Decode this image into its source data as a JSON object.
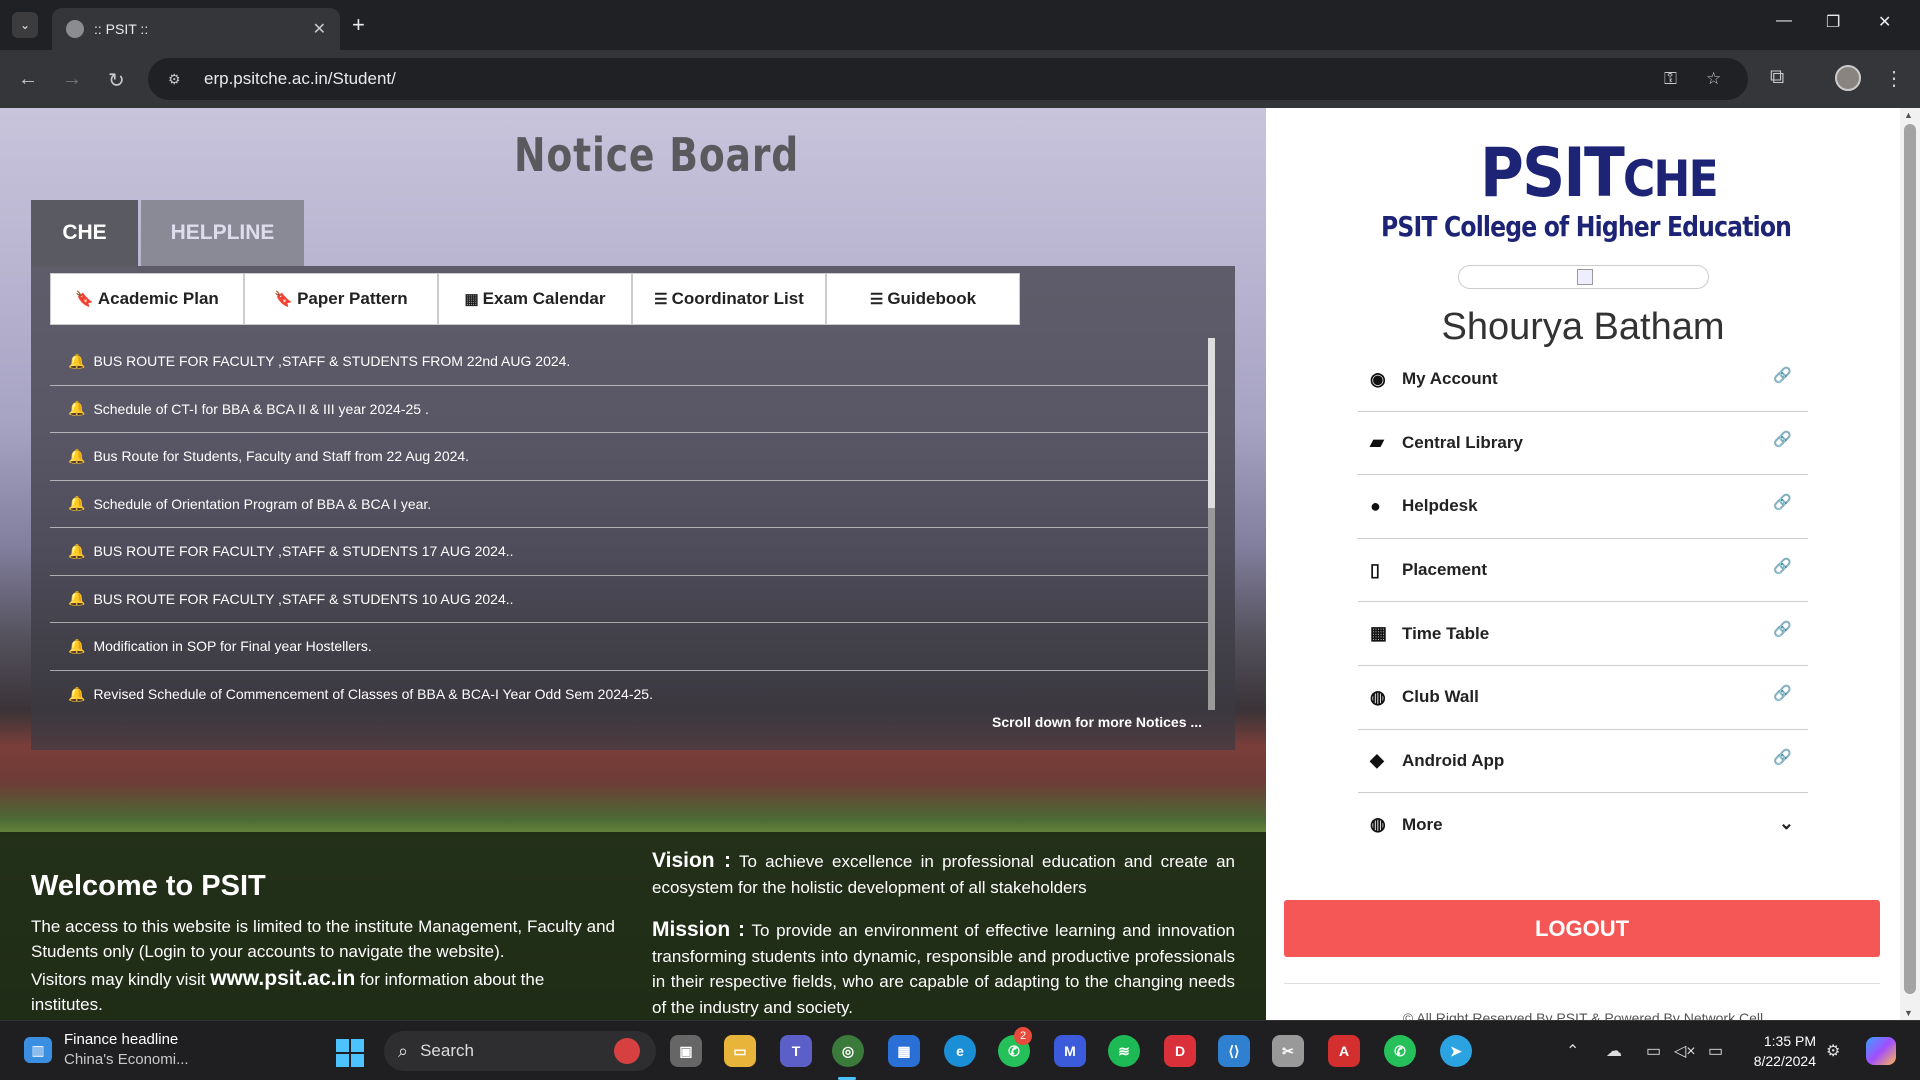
{
  "browser": {
    "tab_title": ":: PSIT ::",
    "url": "erp.psitche.ac.in/Student/"
  },
  "notice_board": {
    "title": "Notice Board",
    "tabs": [
      "CHE",
      "HELPLINE"
    ],
    "pills": [
      "Academic Plan",
      "Paper Pattern",
      "Exam Calendar",
      "Coordinator List",
      "Guidebook"
    ],
    "notices": [
      "BUS ROUTE FOR FACULTY ,STAFF & STUDENTS FROM 22nd AUG 2024.",
      "Schedule of CT-I for BBA & BCA II & III year 2024-25 .",
      "Bus Route for Students, Faculty and Staff from 22 Aug 2024.",
      "Schedule of Orientation Program of BBA & BCA I year.",
      "BUS ROUTE FOR FACULTY ,STAFF & STUDENTS 17 AUG 2024..",
      "BUS ROUTE FOR FACULTY ,STAFF & STUDENTS 10 AUG 2024..",
      "Modification in SOP for Final year Hostellers.",
      "Revised Schedule of Commencement of Classes of BBA & BCA-I Year Odd Sem 2024-25."
    ],
    "scroll_more": "Scroll down for more Notices ..."
  },
  "welcome": {
    "heading": "Welcome to PSIT",
    "text": "The access to this website is limited to the institute Management, Faculty and Students only (Login to your accounts to navigate the website).",
    "visit_prefix": "Visitors may kindly visit",
    "visit_link": "www.psit.ac.in",
    "visit_suffix": "for information about the institutes."
  },
  "vision": {
    "label": "Vision :",
    "text": "To achieve excellence in professional education and create an ecosystem for the holistic development of all stakeholders"
  },
  "mission": {
    "label": "Mission :",
    "text": "To provide an environment of effective learning and innovation transforming students into dynamic, responsible and productive professionals in their respective fields, who are capable of adapting to the changing needs of the industry and society."
  },
  "sidebar": {
    "logo_main": "PSIT",
    "logo_suffix": "CHE",
    "logo_sub": "PSIT College of Higher Education",
    "user_name": "Shourya Batham",
    "menu": [
      "My Account",
      "Central Library",
      "Helpdesk",
      "Placement",
      "Time Table",
      "Club Wall",
      "Android App",
      "More"
    ],
    "logout": "LOGOUT",
    "copyright": "© All Right Reserved By PSIT & Powered By Network Cell"
  },
  "taskbar": {
    "news_title": "Finance headline",
    "news_sub": "China's Economi...",
    "search": "Search",
    "whatsapp_badge": "2",
    "time": "1:35 PM",
    "date": "8/22/2024"
  },
  "colors": {
    "logout": "#f55656",
    "logo": "#1e2475",
    "chrome": "#202124"
  }
}
